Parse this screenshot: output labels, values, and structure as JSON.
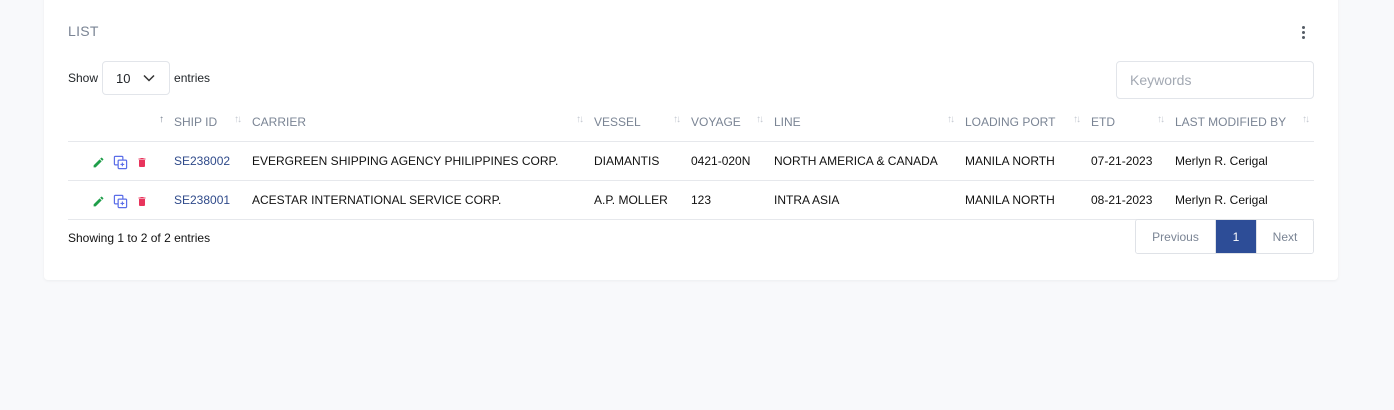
{
  "card": {
    "title": "LIST"
  },
  "length_control": {
    "prefix": "Show",
    "value": "10",
    "suffix": "entries"
  },
  "search": {
    "placeholder": "Keywords"
  },
  "table": {
    "columns": [
      "",
      "SHIP ID",
      "CARRIER",
      "VESSEL",
      "VOYAGE",
      "LINE",
      "LOADING PORT",
      "ETD",
      "LAST MODIFIED BY"
    ],
    "rows": [
      {
        "ship_id": "SE238002",
        "carrier": "EVERGREEN SHIPPING AGENCY PHILIPPINES CORP.",
        "vessel": "DIAMANTIS",
        "voyage": "0421-020N",
        "line": "NORTH AMERICA & CANADA",
        "loading_port": "MANILA NORTH",
        "etd": "07-21-2023",
        "last_modified_by": "Merlyn R. Cerigal"
      },
      {
        "ship_id": "SE238001",
        "carrier": "ACESTAR INTERNATIONAL SERVICE CORP.",
        "vessel": "A.P. MOLLER",
        "voyage": "123",
        "line": "INTRA ASIA",
        "loading_port": "MANILA NORTH",
        "etd": "08-21-2023",
        "last_modified_by": "Merlyn R. Cerigal"
      }
    ]
  },
  "footer": {
    "info": "Showing 1 to 2 of 2 entries",
    "prev_label": "Previous",
    "current_page": "1",
    "next_label": "Next"
  },
  "colors": {
    "accent": "#2d4d97",
    "edit_icon": "#1e9e49",
    "copy_icon": "#5b6ee8",
    "delete_icon": "#e8345c"
  },
  "icons": {
    "menu": "kebab-vertical-icon",
    "edit": "pencil-icon",
    "copy": "copy-icon",
    "delete": "trash-icon",
    "sort": "sort-arrows-icon"
  }
}
